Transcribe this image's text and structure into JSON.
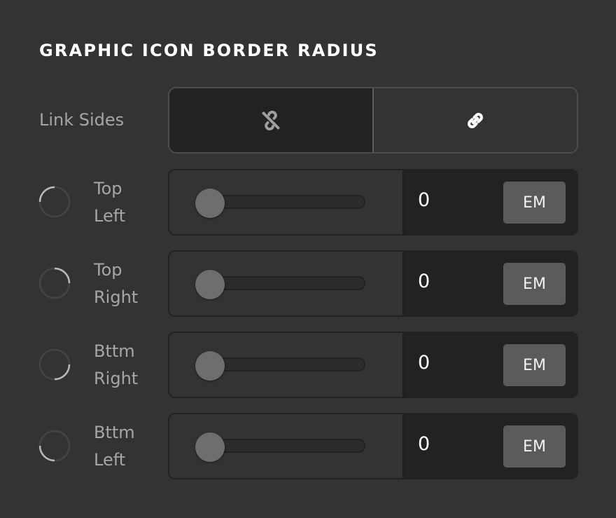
{
  "section": {
    "title": "GRAPHIC ICON BORDER RADIUS"
  },
  "link_sides": {
    "label": "Link Sides",
    "options": [
      {
        "name": "unlink",
        "icon": "unlink-icon",
        "active": false
      },
      {
        "name": "link",
        "icon": "link-icon",
        "active": true
      }
    ]
  },
  "rows": [
    {
      "label_line1": "Top",
      "label_line2": "Left",
      "corner": "top-left",
      "value": "0",
      "unit": "EM",
      "slider_fraction": 0
    },
    {
      "label_line1": "Top",
      "label_line2": "Right",
      "corner": "top-right",
      "value": "0",
      "unit": "EM",
      "slider_fraction": 0
    },
    {
      "label_line1": "Bttm",
      "label_line2": "Right",
      "corner": "bottom-right",
      "value": "0",
      "unit": "EM",
      "slider_fraction": 0
    },
    {
      "label_line1": "Bttm",
      "label_line2": "Left",
      "corner": "bottom-left",
      "value": "0",
      "unit": "EM",
      "slider_fraction": 0
    }
  ],
  "colors": {
    "background": "#333333",
    "dark_field": "#222222",
    "unit_button": "#5b5b5b",
    "thumb": "#6e6e6e"
  }
}
